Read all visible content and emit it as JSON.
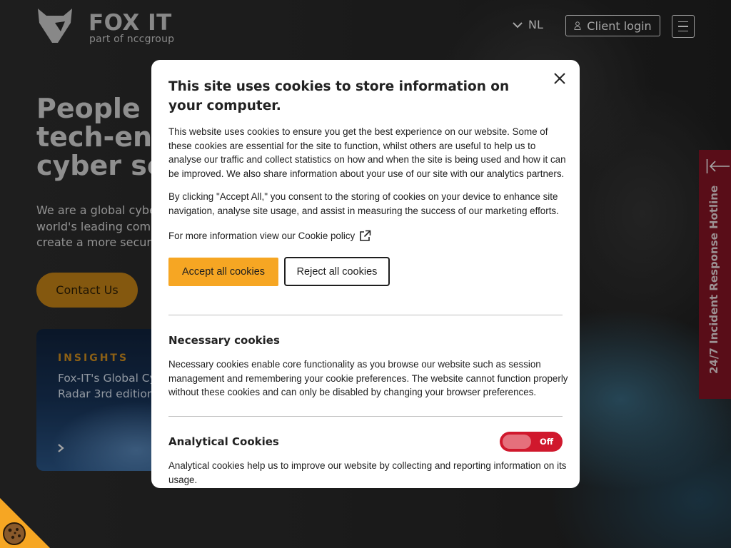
{
  "header": {
    "logo_text": "FOX IT",
    "logo_subtext": "part of nccgroup",
    "language": "NL",
    "client_login": "Client login"
  },
  "hero": {
    "title_lines": [
      "People p",
      "tech-ena",
      "cyber sec"
    ],
    "text_lines": [
      "We are a global cyber",
      "world's leading compa",
      "create a more secure"
    ],
    "contact_button": "Contact Us"
  },
  "insights_card": {
    "label": "INSIGHTS",
    "title_lines": [
      "Fox-IT's Global Cy",
      "Radar 3rd edition"
    ]
  },
  "hotline": {
    "label": "24/7 Incident Response Hotline"
  },
  "cookie_modal": {
    "title": "This site uses cookies to store information on your computer.",
    "paragraph_1": "This website uses cookies to ensure you get the best experience on our website. Some of these cookies are essential for the site to function, whilst others are useful to help us to analyse our traffic and collect statistics on how and when the site is being used and how it can be improved. We also share information about your use of our site with our analytics partners.",
    "paragraph_2": "By clicking \"Accept All,\" you consent to the storing of cookies on your device to enhance site navigation, analyse site usage, and assist in measuring the success of our marketing efforts.",
    "policy_text": "For more information view our Cookie policy",
    "accept_button": "Accept all cookies",
    "reject_button": "Reject all cookies",
    "necessary": {
      "title": "Necessary cookies",
      "description": "Necessary cookies enable core functionality as you browse our website such as session management and remembering your cookie preferences. The website cannot function properly without these cookies and can only be disabled by changing your browser preferences."
    },
    "analytical": {
      "title": "Analytical Cookies",
      "toggle_state": "Off",
      "description": "Analytical cookies help us to improve our website by collecting and reporting information on its usage."
    }
  },
  "colors": {
    "accent_orange": "#f6a623",
    "contact_button": "#b87a16",
    "toggle_off_red": "#d0182d",
    "hotline_red": "#7c1322"
  },
  "icons": [
    "fox-logo-icon",
    "chevron-down-icon",
    "user-icon",
    "hamburger-menu-icon",
    "close-icon",
    "external-link-icon",
    "chevron-right-icon",
    "collapse-arrow-icon",
    "cookie-icon"
  ]
}
